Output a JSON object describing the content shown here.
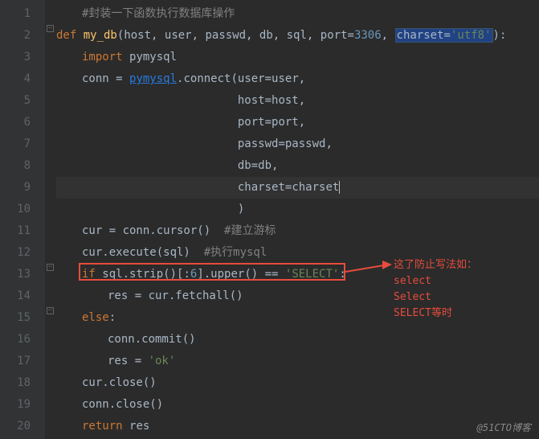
{
  "lines": {
    "l1_comment": "#封装一下函数执行数据库操作",
    "l2_def": "def ",
    "l2_fn": "my_db",
    "l2_p_host": "host",
    "l2_p_user": "user",
    "l2_p_passwd": "passwd",
    "l2_p_db": "db",
    "l2_p_sql": "sql",
    "l2_p_port": "port",
    "l2_portval": "3306",
    "l2_p_charset": "charset",
    "l2_charsetval": "'utf8'",
    "l3_import": "import ",
    "l3_mod": "pymysql",
    "l4_var": "conn = ",
    "l4_pymysql": "pymysql",
    "l4_connect": ".connect(",
    "l4_k_user": "user",
    "l4_v_user": "=user,",
    "l5_k": "host",
    "l5_v": "=host,",
    "l6_k": "port",
    "l6_v": "=port,",
    "l7_k": "passwd",
    "l7_v": "=passwd,",
    "l8_k": "db",
    "l8_v": "=db,",
    "l9_k": "charset",
    "l9_v": "=charset",
    "l10_close": ")",
    "l11_a": "cur = conn.cursor()  ",
    "l11_c": "#建立游标",
    "l12_a": "cur.execute(sql)  ",
    "l12_c": "#执行mysql",
    "l13_if": "if ",
    "l13_expr": "sql.strip()[:",
    "l13_six": "6",
    "l13_up": "].upper() == ",
    "l13_sel": "'SELECT'",
    "l13_colon": ":",
    "l14": "res = cur.fetchall()",
    "l15": "else",
    "l15_colon": ":",
    "l16": "conn.commit()",
    "l17_a": "res = ",
    "l17_s": "'ok'",
    "l18": "cur.close()",
    "l19": "conn.close()",
    "l20_ret": "return ",
    "l20_res": "res"
  },
  "gutter": [
    "1",
    "2",
    "3",
    "4",
    "5",
    "6",
    "7",
    "8",
    "9",
    "10",
    "11",
    "12",
    "13",
    "14",
    "15",
    "16",
    "17",
    "18",
    "19",
    "20"
  ],
  "annotation": {
    "l1": "这了防止写法如：",
    "l2": "select",
    "l3": "Select",
    "l4": "SELECT等时"
  },
  "watermark": "@51CTO博客"
}
